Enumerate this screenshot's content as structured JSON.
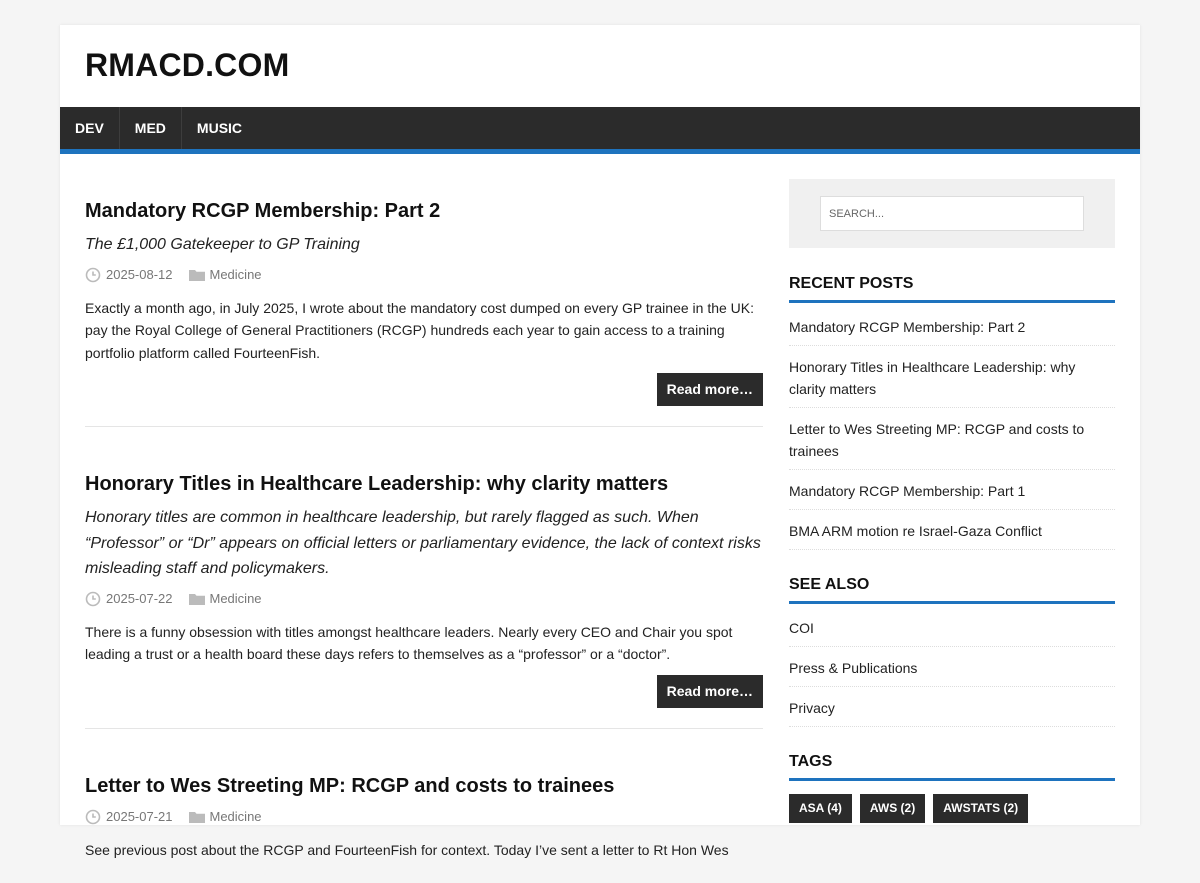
{
  "site": {
    "title": "RMACD.COM"
  },
  "nav": {
    "items": [
      "DEV",
      "MED",
      "MUSIC"
    ]
  },
  "posts": [
    {
      "title": "Mandatory RCGP Membership: Part 2",
      "subtitle": "The £1,000 Gatekeeper to GP Training",
      "date": "2025-08-12",
      "category": "Medicine",
      "excerpt": "Exactly a month ago, in July 2025, I wrote about the mandatory cost dumped on every GP trainee in the UK: pay the Royal College of General Practitioners (RCGP) hundreds each year to gain access to a training portfolio platform called FourteenFish.",
      "read_more": "Read more…"
    },
    {
      "title": "Honorary Titles in Healthcare Leadership: why clarity matters",
      "subtitle": "Honorary titles are common in healthcare leadership, but rarely flagged as such. When “Professor” or “Dr” appears on official letters or parliamentary evidence, the lack of context risks misleading staff and policymakers.",
      "date": "2025-07-22",
      "category": "Medicine",
      "excerpt": "There is a funny obsession with titles amongst healthcare leaders. Nearly every CEO and Chair you spot leading a trust or a health board these days refers to themselves as a “professor” or a “doctor”.",
      "read_more": "Read more…"
    },
    {
      "title": "Letter to Wes Streeting MP: RCGP and costs to trainees",
      "date": "2025-07-21",
      "category": "Medicine",
      "excerpt": "See previous post about the RCGP and FourteenFish for context. Today I’ve sent a letter to Rt Hon Wes"
    }
  ],
  "sidebar": {
    "search_placeholder": "SEARCH...",
    "recent_title": "RECENT POSTS",
    "recent_posts": [
      "Mandatory RCGP Membership: Part 2",
      "Honorary Titles in Healthcare Leadership: why clarity matters",
      "Letter to Wes Streeting MP: RCGP and costs to trainees",
      "Mandatory RCGP Membership: Part 1",
      "BMA ARM motion re Israel-Gaza Conflict"
    ],
    "see_also_title": "SEE ALSO",
    "see_also": [
      "COI",
      "Press & Publications",
      "Privacy"
    ],
    "tags_title": "TAGS",
    "tags": [
      "ASA (4)",
      "AWS (2)",
      "AWSTATS (2)"
    ]
  },
  "icons": {
    "date": "clock-icon",
    "category": "folder-icon"
  },
  "colors": {
    "accent": "#1e73be",
    "dark": "#2b2b2b",
    "meta": "#777777"
  }
}
